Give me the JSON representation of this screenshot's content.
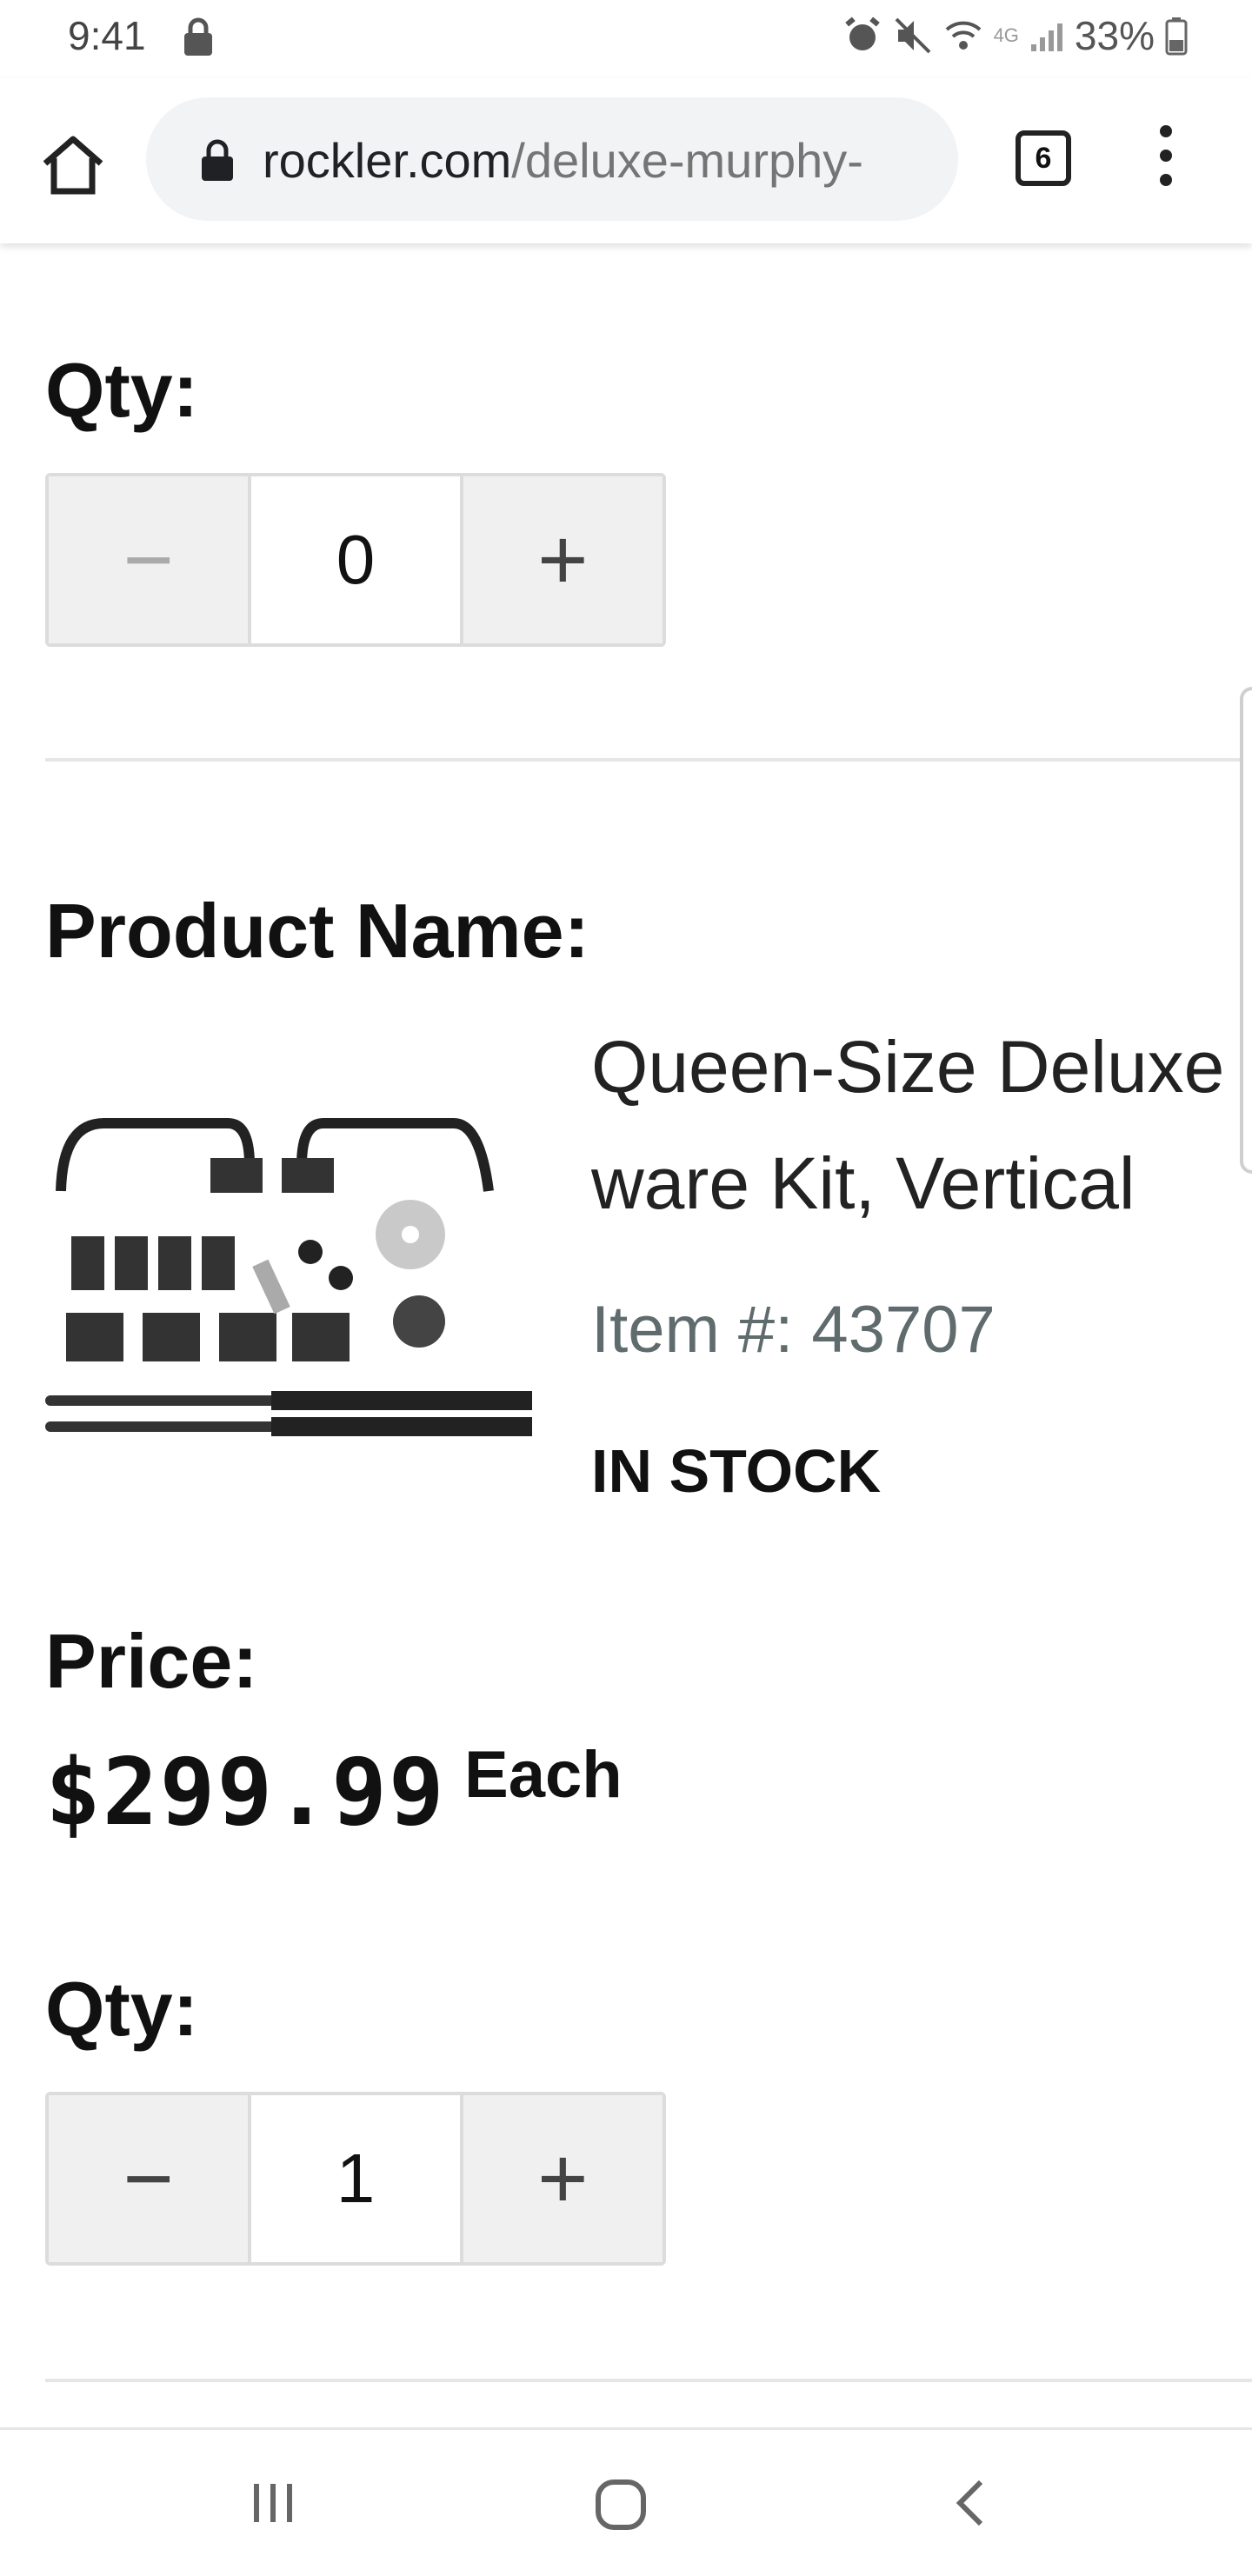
{
  "status_bar": {
    "time": "9:41",
    "network": "4G",
    "battery": "33%"
  },
  "browser": {
    "url_domain": "rockler.com",
    "url_path": "/deluxe-murphy-",
    "tab_count": "6",
    "icons": [
      "home-icon",
      "lock-icon",
      "tabs-icon",
      "more-vert-icon"
    ]
  },
  "qty_section_1": {
    "label": "Qty:",
    "minus": "−",
    "value": "0",
    "plus": "+"
  },
  "product": {
    "name_label": "Product Name:",
    "title_line1": "Queen-Size Deluxe",
    "title_line2": "ware Kit, Vertical",
    "item_number": "Item #: 43707",
    "stock_status": "IN STOCK"
  },
  "price_section": {
    "label": "Price:",
    "amount": "$299.99",
    "unit": "Each"
  },
  "qty_section_2": {
    "label": "Qty:",
    "minus": "−",
    "value": "1",
    "plus": "+"
  },
  "nav": {
    "icons": [
      "recents-icon",
      "home-nav-icon",
      "back-icon"
    ]
  }
}
